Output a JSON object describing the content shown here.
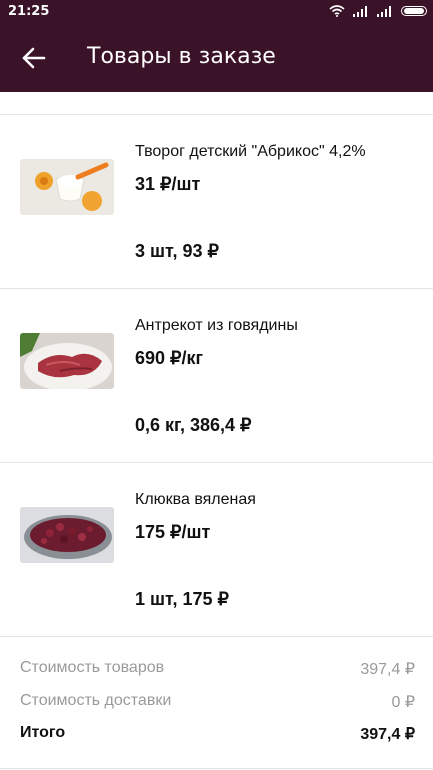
{
  "status_bar": {
    "time": "21:25"
  },
  "header": {
    "title": "Товары в заказе",
    "back_icon": "arrow-left-icon"
  },
  "items": [
    {
      "name": "Творог детский \"Абрикос\" 4,2%",
      "price": "31 ₽/шт",
      "quantity_total": "3 шт, 93 ₽",
      "image": "yogurt-apricot-image"
    },
    {
      "name": "Антрекот из говядины",
      "price": "690 ₽/кг",
      "quantity_total": "0,6 кг, 386,4 ₽",
      "image": "beef-entrecote-image"
    },
    {
      "name": "Клюква вяленая",
      "price": "175 ₽/шт",
      "quantity_total": "1 шт, 175 ₽",
      "image": "dried-cranberry-image"
    }
  ],
  "summary": {
    "goods_label": "Стоимость товаров",
    "goods_value": "397,4 ₽",
    "delivery_label": "Стоимость доставки",
    "delivery_value": "0 ₽",
    "total_label": "Итого",
    "total_value": "397,4 ₽"
  },
  "colors": {
    "header": "#3a1328",
    "divider": "#e4e4e4",
    "muted": "#9a9a9a"
  }
}
